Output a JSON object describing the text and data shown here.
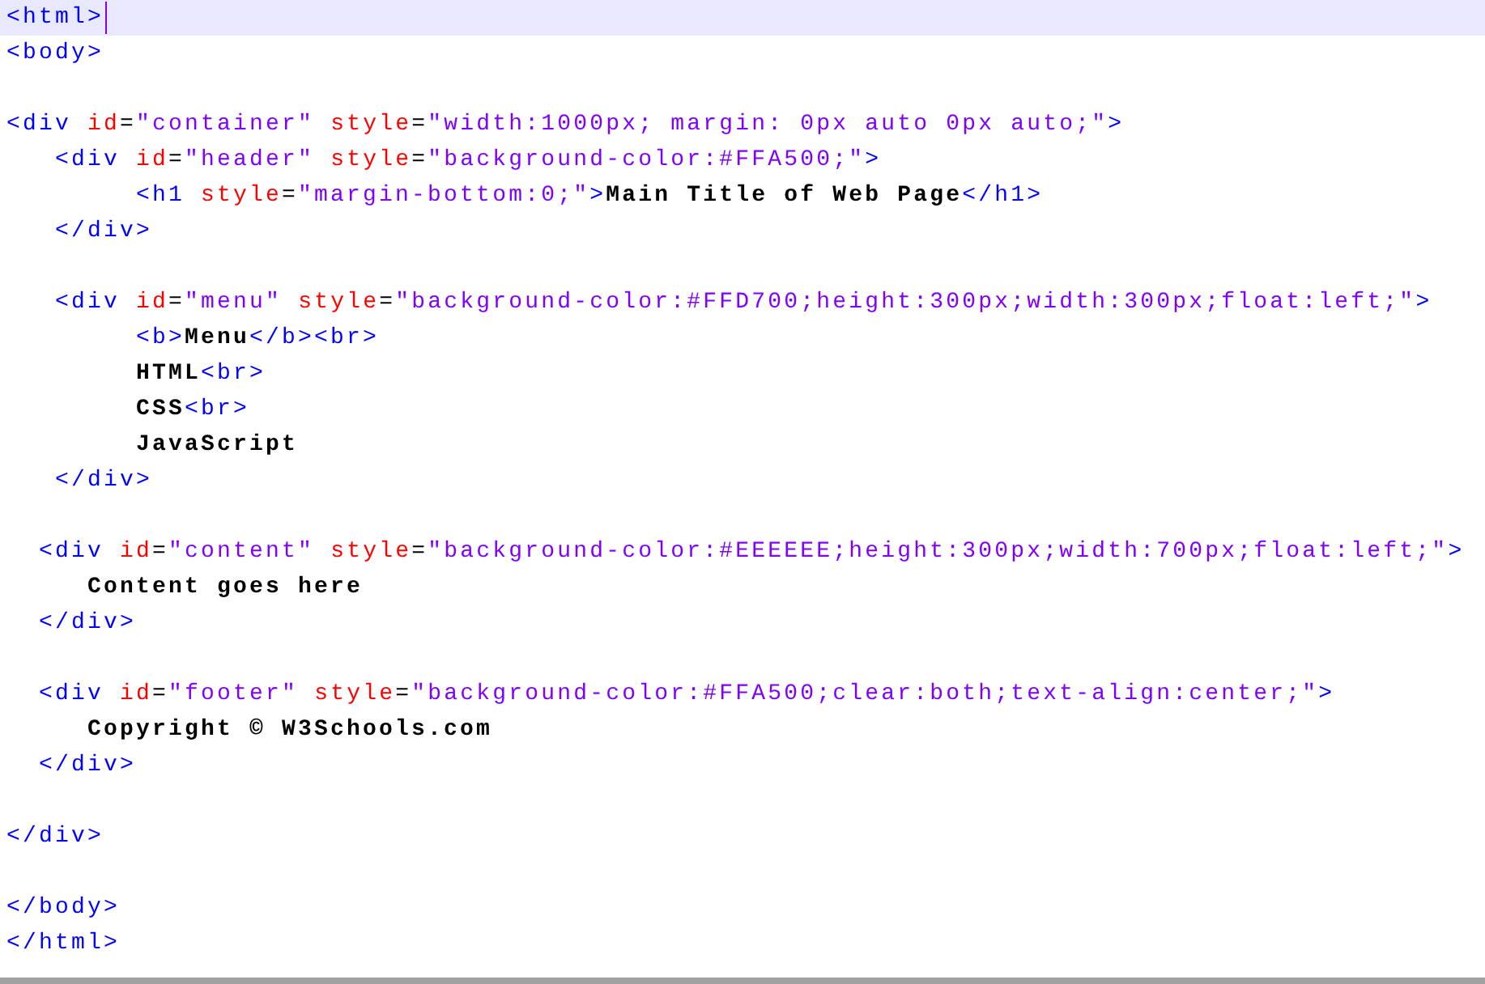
{
  "editor": {
    "lines": [
      {
        "current": true,
        "segments": [
          {
            "kind": "tag",
            "text": "<html>"
          }
        ]
      },
      {
        "current": false,
        "segments": [
          {
            "kind": "tag",
            "text": "<body>"
          }
        ]
      },
      {
        "current": false
      },
      {
        "current": false,
        "segments": [
          {
            "kind": "tag",
            "text": "<div"
          },
          {
            "kind": "attr",
            "text": " id"
          },
          {
            "kind": "eq",
            "text": "="
          },
          {
            "kind": "value",
            "text": "\"container\""
          },
          {
            "kind": "attr",
            "text": " style"
          },
          {
            "kind": "eq",
            "text": "="
          },
          {
            "kind": "value",
            "text": "\"width:1000px; margin: 0px auto 0px auto;\""
          },
          {
            "kind": "tag",
            "text": ">"
          }
        ]
      },
      {
        "current": false,
        "segments": [
          {
            "kind": "tag",
            "text": "   <div"
          },
          {
            "kind": "attr",
            "text": " id"
          },
          {
            "kind": "eq",
            "text": "="
          },
          {
            "kind": "value",
            "text": "\"header\""
          },
          {
            "kind": "attr",
            "text": " style"
          },
          {
            "kind": "eq",
            "text": "="
          },
          {
            "kind": "value",
            "text": "\"background-color:#FFA500;\""
          },
          {
            "kind": "tag",
            "text": ">"
          }
        ]
      },
      {
        "current": false,
        "segments": [
          {
            "kind": "tag",
            "text": "        <h1"
          },
          {
            "kind": "attr",
            "text": " style"
          },
          {
            "kind": "eq",
            "text": "="
          },
          {
            "kind": "value",
            "text": "\"margin-bottom:0;\""
          },
          {
            "kind": "tag",
            "text": ">"
          },
          {
            "kind": "text",
            "text": "Main Title of Web Page"
          },
          {
            "kind": "tag",
            "text": "</h1>"
          }
        ]
      },
      {
        "current": false,
        "segments": [
          {
            "kind": "tag",
            "text": "   </div>"
          }
        ]
      },
      {
        "current": false
      },
      {
        "current": false,
        "segments": [
          {
            "kind": "tag",
            "text": "   <div"
          },
          {
            "kind": "attr",
            "text": " id"
          },
          {
            "kind": "eq",
            "text": "="
          },
          {
            "kind": "value",
            "text": "\"menu\""
          },
          {
            "kind": "attr",
            "text": " style"
          },
          {
            "kind": "eq",
            "text": "="
          },
          {
            "kind": "value",
            "text": "\"background-color:#FFD700;height:300px;width:300px;float:left;\""
          },
          {
            "kind": "tag",
            "text": ">"
          }
        ]
      },
      {
        "current": false,
        "segments": [
          {
            "kind": "tag",
            "text": "        <b>"
          },
          {
            "kind": "text",
            "text": "Menu"
          },
          {
            "kind": "tag",
            "text": "</b><br>"
          }
        ]
      },
      {
        "current": false,
        "segments": [
          {
            "kind": "text",
            "text": "        HTML"
          },
          {
            "kind": "tag",
            "text": "<br>"
          }
        ]
      },
      {
        "current": false,
        "segments": [
          {
            "kind": "text",
            "text": "        CSS"
          },
          {
            "kind": "tag",
            "text": "<br>"
          }
        ]
      },
      {
        "current": false,
        "segments": [
          {
            "kind": "text",
            "text": "        JavaScript"
          }
        ]
      },
      {
        "current": false,
        "segments": [
          {
            "kind": "tag",
            "text": "   </div>"
          }
        ]
      },
      {
        "current": false
      },
      {
        "current": false,
        "segments": [
          {
            "kind": "tag",
            "text": "  <div"
          },
          {
            "kind": "attr",
            "text": " id"
          },
          {
            "kind": "eq",
            "text": "="
          },
          {
            "kind": "value",
            "text": "\"content\""
          },
          {
            "kind": "attr",
            "text": " style"
          },
          {
            "kind": "eq",
            "text": "="
          },
          {
            "kind": "value",
            "text": "\"background-color:#EEEEEE;height:300px;width:700px;float:left;\""
          },
          {
            "kind": "tag",
            "text": ">"
          }
        ]
      },
      {
        "current": false,
        "segments": [
          {
            "kind": "text",
            "text": "     Content goes here"
          }
        ]
      },
      {
        "current": false,
        "segments": [
          {
            "kind": "tag",
            "text": "  </div>"
          }
        ]
      },
      {
        "current": false
      },
      {
        "current": false,
        "segments": [
          {
            "kind": "tag",
            "text": "  <div"
          },
          {
            "kind": "attr",
            "text": " id"
          },
          {
            "kind": "eq",
            "text": "="
          },
          {
            "kind": "value",
            "text": "\"footer\""
          },
          {
            "kind": "attr",
            "text": " style"
          },
          {
            "kind": "eq",
            "text": "="
          },
          {
            "kind": "value",
            "text": "\"background-color:#FFA500;clear:both;text-align:center;\""
          },
          {
            "kind": "tag",
            "text": ">"
          }
        ]
      },
      {
        "current": false,
        "segments": [
          {
            "kind": "text",
            "text": "     Copyright © W3Schools.com"
          }
        ]
      },
      {
        "current": false,
        "segments": [
          {
            "kind": "tag",
            "text": "  </div>"
          }
        ]
      },
      {
        "current": false
      },
      {
        "current": false,
        "segments": [
          {
            "kind": "tag",
            "text": "</div>"
          }
        ]
      },
      {
        "current": false
      },
      {
        "current": false,
        "segments": [
          {
            "kind": "tag",
            "text": "</body>"
          }
        ]
      },
      {
        "current": false,
        "segments": [
          {
            "kind": "tag",
            "text": "</html>"
          }
        ]
      }
    ]
  }
}
